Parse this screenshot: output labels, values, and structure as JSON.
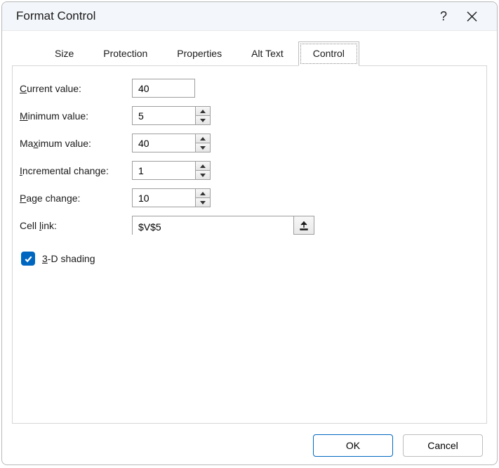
{
  "dialog": {
    "title": "Format Control"
  },
  "tabs": {
    "size": "Size",
    "protection": "Protection",
    "properties": "Properties",
    "alt_text": "Alt Text",
    "control": "Control"
  },
  "labels": {
    "current_value_pre": "C",
    "current_value_post": "urrent value:",
    "minimum_value_pre": "M",
    "minimum_value_post": "inimum value:",
    "maximum_value_pre": "Ma",
    "maximum_value_mid": "x",
    "maximum_value_post": "imum value:",
    "incremental_change_pre": "I",
    "incremental_change_post": "ncremental change:",
    "page_change_pre": "P",
    "page_change_post": "age change:",
    "cell_link_pre": "Cell ",
    "cell_link_mid": "l",
    "cell_link_post": "ink:",
    "shading_pre": "3",
    "shading_post": "-D shading"
  },
  "values": {
    "current_value": "40",
    "minimum_value": "5",
    "maximum_value": "40",
    "incremental_change": "1",
    "page_change": "10",
    "cell_link": "$V$5",
    "shading_checked": true
  },
  "footer": {
    "ok": "OK",
    "cancel": "Cancel"
  }
}
